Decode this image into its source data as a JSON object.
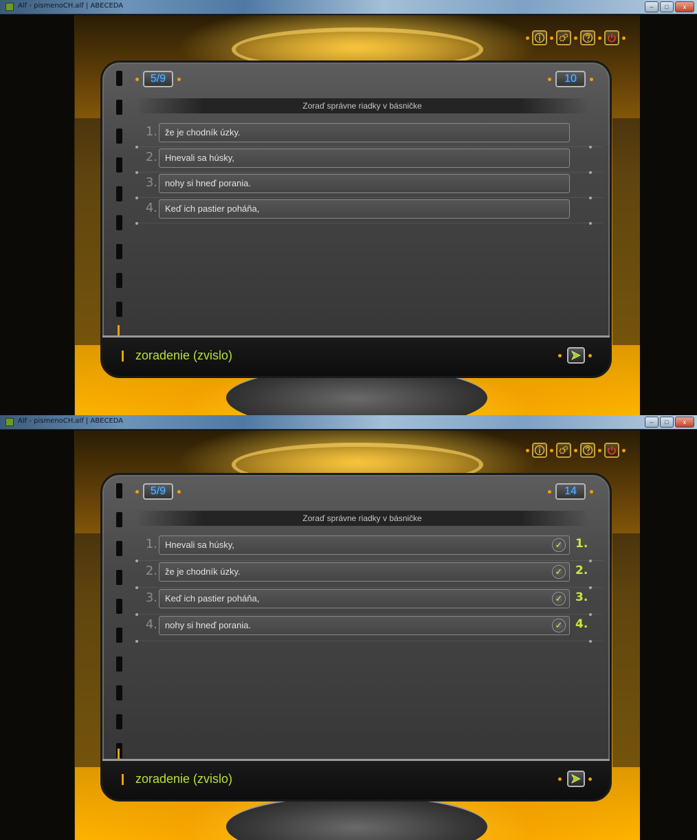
{
  "window": {
    "title": "Alf - pismenoCH.alf | ABECEDA",
    "controls": {
      "minimize": "–",
      "maximize": "□",
      "close": "x"
    }
  },
  "toolbar_icons": [
    "info-icon",
    "settings-gears-icon",
    "help-icon",
    "power-icon"
  ],
  "colors": {
    "accent_orange": "#f4a000",
    "counter_blue": "#5ab4ff",
    "check_green": "#c7e83a"
  },
  "screens": [
    {
      "progress": "5/9",
      "score": "10",
      "instruction": "Zoraď správne riadky v básničke",
      "rows": [
        {
          "num": "1.",
          "text": "že je chodník úzky."
        },
        {
          "num": "2.",
          "text": "Hnevali sa húsky,"
        },
        {
          "num": "3.",
          "text": "nohy si hneď porania."
        },
        {
          "num": "4.",
          "text": "Keď ich pastier poháňa,"
        }
      ],
      "task_type": "zoradenie (zvislo)"
    },
    {
      "progress": "5/9",
      "score": "14",
      "instruction": "Zoraď správne riadky v básničke",
      "rows": [
        {
          "num": "1.",
          "text": "Hnevali sa húsky,",
          "check": "✓",
          "correct": "1."
        },
        {
          "num": "2.",
          "text": "že je chodník úzky.",
          "check": "✓",
          "correct": "2."
        },
        {
          "num": "3.",
          "text": "Keď ich pastier poháňa,",
          "check": "✓",
          "correct": "3."
        },
        {
          "num": "4.",
          "text": "nohy si hneď porania.",
          "check": "✓",
          "correct": "4."
        }
      ],
      "task_type": "zoradenie (zvislo)"
    }
  ]
}
